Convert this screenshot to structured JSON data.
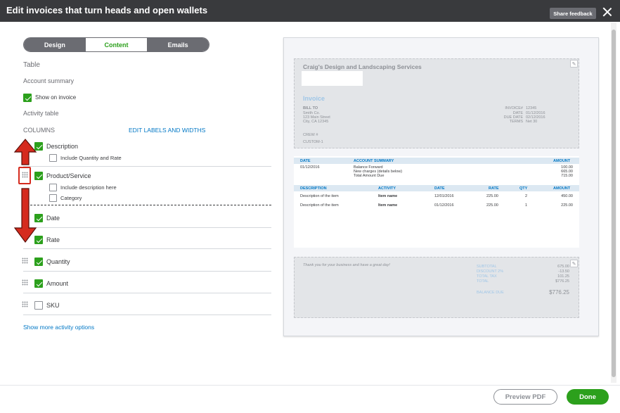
{
  "window": {
    "title": "Edit invoices that turn heads and open wallets",
    "share_label": "Share feedback"
  },
  "tabs": [
    {
      "label": "Design"
    },
    {
      "label": "Content",
      "active": true
    },
    {
      "label": "Emails"
    }
  ],
  "section": {
    "table_label": "Table",
    "account_summary_label": "Account summary",
    "show_on_invoice_label": "Show on invoice",
    "activity_table_label": "Activity table",
    "columns_label": "COLUMNS",
    "edit_labels_link": "EDIT LABELS AND WIDTHS",
    "show_more_link": "Show more activity options"
  },
  "columns": [
    {
      "label": "Description",
      "checked": true,
      "sub": [
        "Include Quantity and Rate"
      ]
    },
    {
      "label": "Product/Service",
      "checked": true,
      "sub": [
        "Include description here",
        "Category"
      ]
    },
    {
      "label": "Date",
      "checked": true
    },
    {
      "label": "Rate",
      "checked": true
    },
    {
      "label": "Quantity",
      "checked": true
    },
    {
      "label": "Amount",
      "checked": true
    },
    {
      "label": "SKU",
      "checked": false
    }
  ],
  "preview": {
    "company": "Craig's Design and Landscaping Services",
    "invoice_title": "Invoice",
    "bill_to": [
      "BILL TO",
      "Smith Co.",
      "123 Main Street",
      "City, CA 12345"
    ],
    "meta_labels": [
      "INVOICE#",
      "DATE",
      "DUE DATE",
      "TERMS"
    ],
    "meta_values": [
      "12345",
      "01/12/2016",
      "02/12/2016",
      "Net 30"
    ],
    "crew": "CREW #",
    "custom": "CUSTOM-1",
    "summary_headers": [
      "DATE",
      "ACCOUNT SUMMARY",
      "AMOUNT"
    ],
    "summary_date": "01/12/2016",
    "summary_lines": [
      "Balance Forward",
      "New charges (details below)",
      "Total Amount Due"
    ],
    "summary_amounts": [
      "100.00",
      "665.00",
      "715.00"
    ],
    "activity_headers": [
      "DESCRIPTION",
      "ACTIVITY",
      "DATE",
      "RATE",
      "QTY",
      "AMOUNT"
    ],
    "rows": [
      {
        "description": "Description of the item",
        "activity": "Item name",
        "date": "12/01/2016",
        "rate": "225.00",
        "qty": "2",
        "amount": "450.00"
      },
      {
        "description": "Description of the item",
        "activity": "Item name",
        "date": "01/12/2016",
        "rate": "225.00",
        "qty": "1",
        "amount": "225.00"
      }
    ],
    "thanks": "Thank you for your business and have a great day!",
    "totals_labels": [
      "SUBTOTAL",
      "DISCOUNT 2%",
      "TOTAL TAX",
      "TOTAL"
    ],
    "totals_values": [
      "675.00",
      "-13.50",
      "101.25",
      "$776.25"
    ],
    "balance_label": "BALANCE DUE",
    "balance_value": "$776.25"
  },
  "footer": {
    "preview_label": "Preview PDF",
    "done_label": "Done"
  },
  "colors": {
    "accent": "#2ca01c",
    "link": "#0077c5",
    "annotation": "#d52b1e"
  }
}
